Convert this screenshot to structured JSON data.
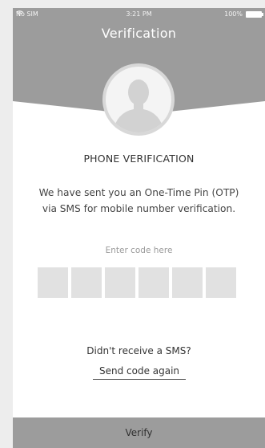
{
  "colors": {
    "header": "#9c9c9c",
    "background": "#ffffff",
    "code_box": "#e1e1e1",
    "button": "#9c9c9c"
  },
  "status_bar": {
    "carrier": "No SIM",
    "wifi_icon": "wifi-icon",
    "time": "3:21 PM",
    "battery": "100%",
    "battery_icon": "battery-full-icon"
  },
  "header": {
    "title": "Verification",
    "avatar_icon": "user-silhouette-icon"
  },
  "content": {
    "heading": "PHONE VERIFICATION",
    "description_line1": "We have sent you an One-Time Pin (OTP)",
    "description_line2": "via SMS for mobile number verification.",
    "code_label": "Enter code here",
    "code_digits": [
      "",
      "",
      "",
      "",
      "",
      ""
    ],
    "resend_question": "Didn't receive a SMS?",
    "resend_link": "Send code again"
  },
  "footer": {
    "verify_label": "Verify"
  }
}
